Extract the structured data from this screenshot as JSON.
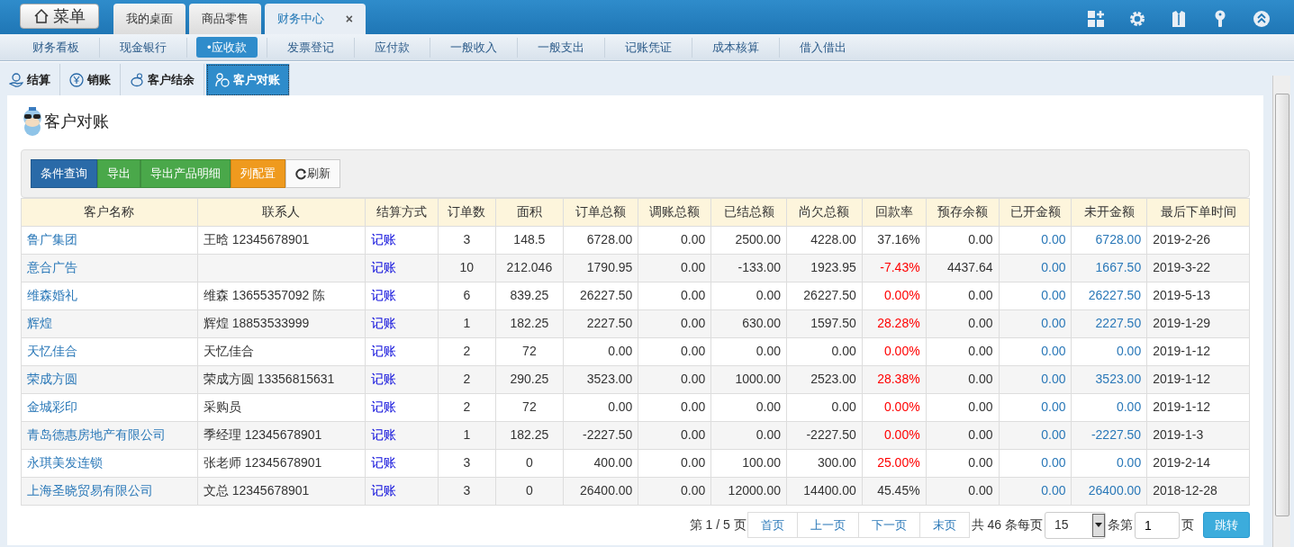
{
  "menu_button": {
    "label": "菜单"
  },
  "window_tabs": [
    {
      "label": "我的桌面",
      "selected": false
    },
    {
      "label": "商品零售",
      "selected": false
    },
    {
      "label": "财务中心",
      "selected": true,
      "close_glyph": "×"
    }
  ],
  "module_nav": [
    {
      "label": "财务看板",
      "selected": false
    },
    {
      "label": "现金银行",
      "selected": false
    },
    {
      "label": "•应收款",
      "selected": true
    },
    {
      "label": "发票登记",
      "selected": false
    },
    {
      "label": "应付款",
      "selected": false
    },
    {
      "label": "一般收入",
      "selected": false
    },
    {
      "label": "一般支出",
      "selected": false
    },
    {
      "label": "记账凭证",
      "selected": false
    },
    {
      "label": "成本核算",
      "selected": false
    },
    {
      "label": "借入借出",
      "selected": false
    }
  ],
  "sub_tabs": [
    {
      "label": "结算",
      "selected": false
    },
    {
      "label": "销账",
      "selected": false
    },
    {
      "label": "客户结余",
      "selected": false
    },
    {
      "label": "客户对账",
      "selected": true
    }
  ],
  "page_title": "客户对账",
  "toolbar": [
    {
      "label": "条件查询",
      "kind": "primary"
    },
    {
      "label": "导出",
      "kind": "success"
    },
    {
      "label": "导出产品明细",
      "kind": "success"
    },
    {
      "label": "列配置",
      "kind": "warning"
    },
    {
      "label": "刷新",
      "kind": "refresh"
    }
  ],
  "table": {
    "columns": [
      {
        "label": "客户名称",
        "kind": "name"
      },
      {
        "label": "联系人",
        "kind": "text"
      },
      {
        "label": "结算方式",
        "kind": "method"
      },
      {
        "label": "订单数",
        "kind": "center"
      },
      {
        "label": "面积",
        "kind": "center"
      },
      {
        "label": "订单总额",
        "kind": "number"
      },
      {
        "label": "调账总额",
        "kind": "number"
      },
      {
        "label": "已结总额",
        "kind": "number"
      },
      {
        "label": "尚欠总额",
        "kind": "number"
      },
      {
        "label": "回款率",
        "kind": "rate"
      },
      {
        "label": "预存余额",
        "kind": "number"
      },
      {
        "label": "已开金额",
        "kind": "amount_link"
      },
      {
        "label": "未开金额",
        "kind": "amount_link"
      },
      {
        "label": "最后下单时间",
        "kind": "text"
      }
    ],
    "rows": [
      {
        "cells": [
          "鲁广集团",
          "王晗 12345678901",
          "记账",
          "3",
          "148.5",
          "6728.00",
          "0.00",
          "2500.00",
          "4228.00",
          "37.16%",
          "0.00",
          "0.00",
          "6728.00",
          "2019-2-26"
        ],
        "rate_warning": false
      },
      {
        "cells": [
          "意合广告",
          "",
          "记账",
          "10",
          "212.046",
          "1790.95",
          "0.00",
          "-133.00",
          "1923.95",
          "-7.43%",
          "4437.64",
          "0.00",
          "1667.50",
          "2019-3-22"
        ],
        "rate_warning": true
      },
      {
        "cells": [
          "维森婚礼",
          "维森 13655357092 陈",
          "记账",
          "6",
          "839.25",
          "26227.50",
          "0.00",
          "0.00",
          "26227.50",
          "0.00%",
          "0.00",
          "0.00",
          "26227.50",
          "2019-5-13"
        ],
        "rate_warning": true
      },
      {
        "cells": [
          "辉煌",
          "辉煌 18853533999",
          "记账",
          "1",
          "182.25",
          "2227.50",
          "0.00",
          "630.00",
          "1597.50",
          "28.28%",
          "0.00",
          "0.00",
          "2227.50",
          "2019-1-29"
        ],
        "rate_warning": true
      },
      {
        "cells": [
          "天忆佳合",
          "天忆佳合",
          "记账",
          "2",
          "72",
          "0.00",
          "0.00",
          "0.00",
          "0.00",
          "0.00%",
          "0.00",
          "0.00",
          "0.00",
          "2019-1-12"
        ],
        "rate_warning": true
      },
      {
        "cells": [
          "荣成方圆",
          "荣成方圆 13356815631",
          "记账",
          "2",
          "290.25",
          "3523.00",
          "0.00",
          "1000.00",
          "2523.00",
          "28.38%",
          "0.00",
          "0.00",
          "3523.00",
          "2019-1-12"
        ],
        "rate_warning": true
      },
      {
        "cells": [
          "金城彩印",
          "采购员",
          "记账",
          "2",
          "72",
          "0.00",
          "0.00",
          "0.00",
          "0.00",
          "0.00%",
          "0.00",
          "0.00",
          "0.00",
          "2019-1-12"
        ],
        "rate_warning": true
      },
      {
        "cells": [
          "青岛德惠房地产有限公司",
          "季经理 12345678901",
          "记账",
          "1",
          "182.25",
          "-2227.50",
          "0.00",
          "0.00",
          "-2227.50",
          "0.00%",
          "0.00",
          "0.00",
          "-2227.50",
          "2019-1-3"
        ],
        "rate_warning": true
      },
      {
        "cells": [
          "永琪美发连锁",
          "张老师 12345678901",
          "记账",
          "3",
          "0",
          "400.00",
          "0.00",
          "100.00",
          "300.00",
          "25.00%",
          "0.00",
          "0.00",
          "0.00",
          "2019-2-14"
        ],
        "rate_warning": true
      },
      {
        "cells": [
          "上海圣晓贸易有限公司",
          "文总 12345678901",
          "记账",
          "3",
          "0",
          "26400.00",
          "0.00",
          "12000.00",
          "14400.00",
          "45.45%",
          "0.00",
          "0.00",
          "26400.00",
          "2018-12-28"
        ],
        "rate_warning": false
      }
    ]
  },
  "pagination": {
    "page_info": "第 1 / 5 页",
    "buttons": [
      "首页",
      "上一页",
      "下一页",
      "末页"
    ],
    "total": "共 46 条每页",
    "page_size": "15",
    "row_label": "条第",
    "page_input": "1",
    "page_suffix": "页",
    "go": "跳转"
  }
}
